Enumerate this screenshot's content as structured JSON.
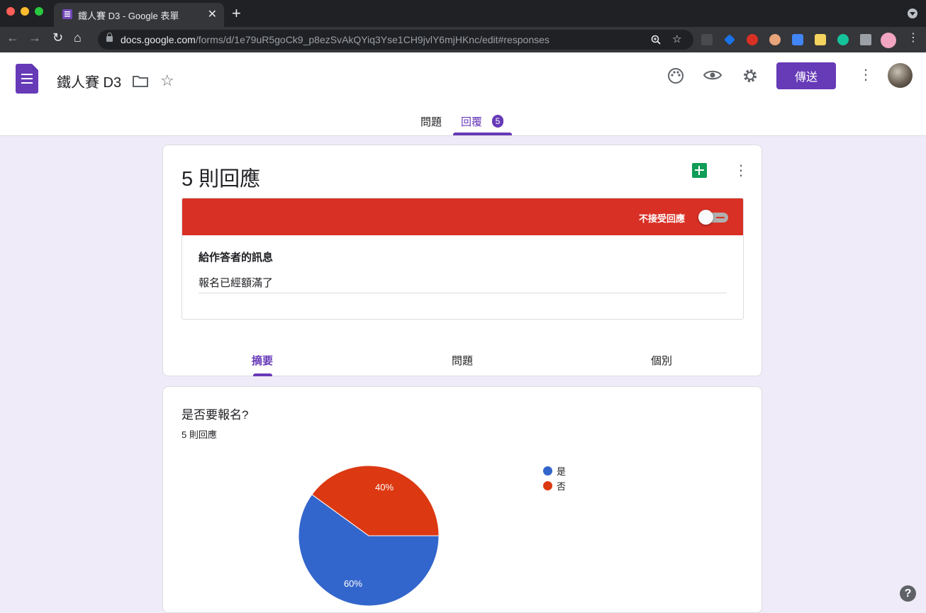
{
  "browser": {
    "tab_title": "鐵人賽 D3 - Google 表單",
    "tab_close": "✕",
    "new_tab": "+",
    "url_host": "docs.google.com",
    "url_path": "/forms/d/1e79uR5goCk9_p8ezSvAkQYiq3Yse1CH9jvlY6mjHKnc/edit#responses"
  },
  "header": {
    "doc_title": "鐵人賽 D3",
    "send_label": "傳送",
    "tabs": [
      {
        "label": "問題"
      },
      {
        "label": "回覆"
      }
    ],
    "response_badge": "5"
  },
  "responses_card": {
    "count_title": "5 則回應",
    "accepting_label": "不接受回應",
    "message_label": "給作答者的訊息",
    "message_value": "報名已經額滿了",
    "sub_tabs": [
      {
        "label": "摘要"
      },
      {
        "label": "問題"
      },
      {
        "label": "個別"
      }
    ]
  },
  "question_card": {
    "title": "是否要報名?",
    "count": "5 則回應"
  },
  "chart_data": {
    "type": "pie",
    "categories": [
      "是",
      "否"
    ],
    "values": [
      60,
      40
    ],
    "labels": [
      "60%",
      "40%"
    ],
    "colors": [
      "#3366cc",
      "#dc3912"
    ],
    "legend": "right"
  },
  "colors": {
    "accent": "#673ab7",
    "banner_red": "#d93025"
  },
  "help_label": "?"
}
